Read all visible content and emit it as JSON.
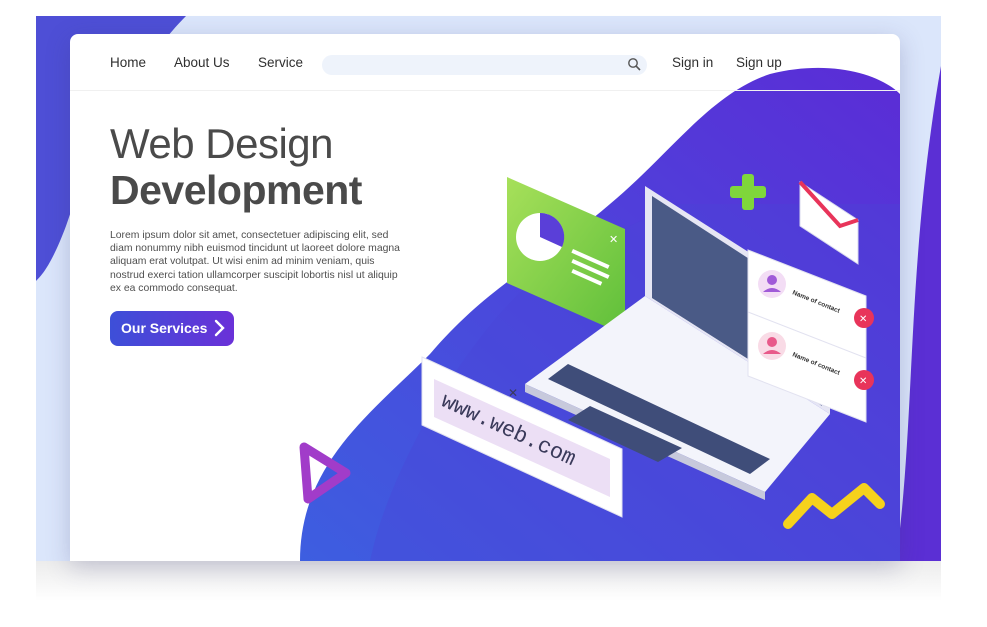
{
  "nav": {
    "home": "Home",
    "about": "About Us",
    "service": "Service",
    "signin": "Sign in",
    "signup": "Sign up",
    "search_placeholder": ""
  },
  "hero": {
    "title_line1": "Web Design",
    "title_line2": "Development",
    "body": "Lorem ipsum dolor sit amet, consectetuer adipiscing elit, sed diam nonummy nibh euismod tincidunt ut laoreet dolore magna aliquam erat volutpat. Ut wisi enim ad minim veniam, quis nostrud exerci tation ullamcorper suscipit lobortis nisl ut aliquip ex ea commodo consequat.",
    "cta": "Our Services"
  },
  "illustration": {
    "url_text": "www.web.com",
    "contact_card_1": "Name of contact",
    "contact_card_2": "Name of contact"
  },
  "colors": {
    "accent_purple": "#5a2fd6",
    "accent_blue": "#3d4fd8",
    "green": "#8bd34a",
    "red_badge": "#e8345a",
    "yellow": "#f6d21c"
  }
}
